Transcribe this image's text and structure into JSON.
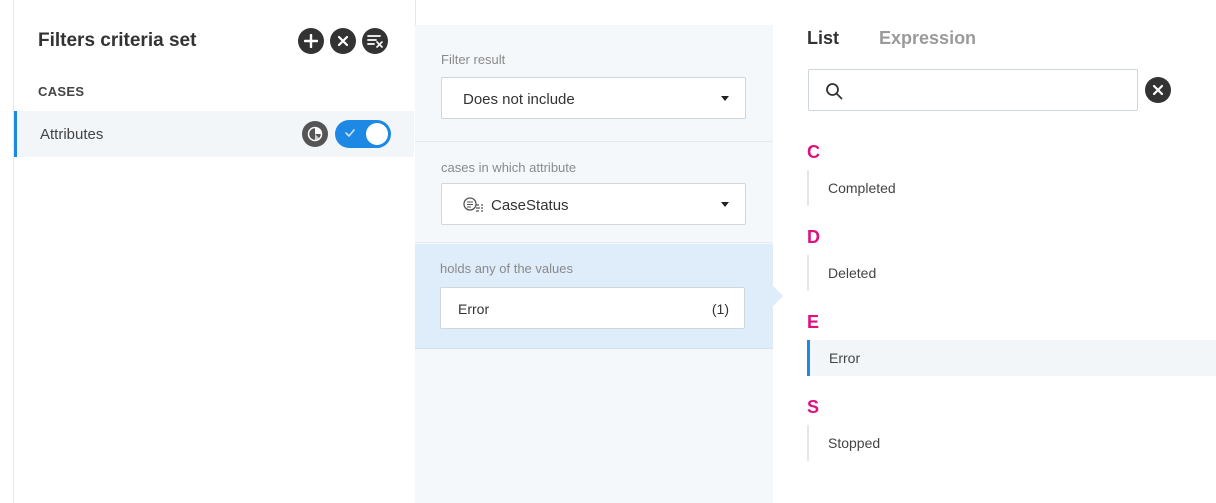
{
  "left_panel": {
    "title": "Filters criteria set",
    "actions": [
      {
        "icon": "plus-icon"
      },
      {
        "icon": "close-icon"
      },
      {
        "icon": "clear-filter-icon"
      }
    ],
    "section_label": "CASES",
    "attribute_row": {
      "label": "Attributes",
      "pie_icon": "pie-chart-icon",
      "toggle_on": true,
      "toggle_color": "#1e88e5"
    }
  },
  "middle_panel": {
    "filter_result": {
      "label": "Filter result",
      "value": "Does not include"
    },
    "attribute": {
      "label": "cases in which attribute",
      "value": "CaseStatus",
      "icon": "attribute-icon"
    },
    "values": {
      "label": "holds any of the values",
      "value": "Error",
      "count": "(1)"
    }
  },
  "right_panel": {
    "tabs": [
      {
        "label": "List",
        "active": true
      },
      {
        "label": "Expression",
        "active": false
      }
    ],
    "search": {
      "placeholder": "",
      "value": ""
    },
    "groups": [
      {
        "letter": "C",
        "items": [
          {
            "label": "Completed",
            "selected": false
          }
        ]
      },
      {
        "letter": "D",
        "items": [
          {
            "label": "Deleted",
            "selected": false
          }
        ]
      },
      {
        "letter": "E",
        "items": [
          {
            "label": "Error",
            "selected": true
          }
        ]
      },
      {
        "letter": "S",
        "items": [
          {
            "label": "Stopped",
            "selected": false
          }
        ]
      }
    ],
    "letter_color": "#e0107f"
  }
}
